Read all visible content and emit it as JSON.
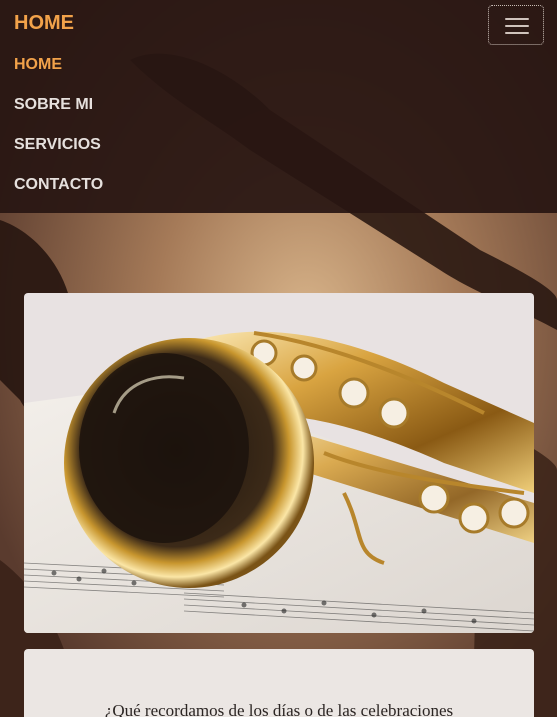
{
  "navbar": {
    "brand": "HOME",
    "toggle_icon": "hamburger-menu-icon",
    "items": [
      {
        "label": "HOME",
        "active": true
      },
      {
        "label": "SOBRE MI",
        "active": false
      },
      {
        "label": "SERVICIOS",
        "active": false
      },
      {
        "label": "CONTACTO",
        "active": false
      }
    ]
  },
  "hero": {
    "image_subject": "saxophone-on-sheet-music"
  },
  "card": {
    "text": "¿Qué recordamos de los días o de las celebraciones"
  },
  "colors": {
    "accent": "#f2a24a",
    "navbar_bg": "#281612",
    "nav_text": "#e6e0dd",
    "card_bg": "#ebe6e3"
  }
}
